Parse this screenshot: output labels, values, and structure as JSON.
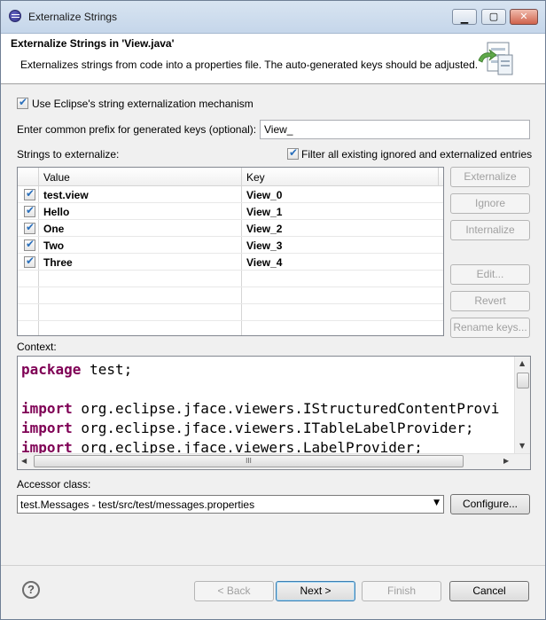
{
  "window": {
    "title": "Externalize Strings",
    "minimize_icon": "minimize-icon",
    "maximize_icon": "maximize-icon",
    "close_icon": "close-icon",
    "min_glyph": "▁",
    "max_glyph": "▢",
    "close_glyph": "✕"
  },
  "header": {
    "title": "Externalize Strings in 'View.java'",
    "description": "Externalizes strings from code into a properties file. The auto-generated keys should be adjusted.",
    "icon": "wizard-banner-icon"
  },
  "options": {
    "use_eclipse_mechanism_label": "Use Eclipse's string externalization mechanism",
    "use_eclipse_mechanism_checked": true,
    "prefix_label": "Enter common prefix for generated keys (optional):",
    "prefix_value": "View_",
    "strings_label": "Strings to externalize:",
    "filter_label": "Filter all existing ignored and externalized entries",
    "filter_checked": true
  },
  "table": {
    "columns": [
      "Value",
      "Key"
    ],
    "rows": [
      {
        "value": "test.view",
        "key": "View_0",
        "checked": true
      },
      {
        "value": "Hello",
        "key": "View_1",
        "checked": true
      },
      {
        "value": "One",
        "key": "View_2",
        "checked": true
      },
      {
        "value": "Two",
        "key": "View_3",
        "checked": true
      },
      {
        "value": "Three",
        "key": "View_4",
        "checked": true
      }
    ],
    "check_glyph": "✔"
  },
  "side_buttons": {
    "externalize": "Externalize",
    "ignore": "Ignore",
    "internalize": "Internalize",
    "edit": "Edit...",
    "revert": "Revert",
    "rename_keys": "Rename keys..."
  },
  "context": {
    "label": "Context:",
    "lines": [
      {
        "kw": "package",
        "rest": " test;"
      },
      {
        "kw": "",
        "rest": ""
      },
      {
        "kw": "import",
        "rest": " org.eclipse.jface.viewers.IStructuredContentProvi"
      },
      {
        "kw": "import",
        "rest": " org.eclipse.jface.viewers.ITableLabelProvider;"
      },
      {
        "kw": "import",
        "rest": " org.eclipse.jface.viewers.LabelProvider;"
      }
    ],
    "scroll_up": "▲",
    "scroll_down": "▼",
    "scroll_left": "◀",
    "scroll_right": "▶",
    "grip": "III"
  },
  "accessor": {
    "label": "Accessor class:",
    "selected": "test.Messages - test/src/test/messages.properties",
    "dropdown_glyph": "▼",
    "configure_button": "Configure..."
  },
  "footer": {
    "help_glyph": "?",
    "back_button": "< Back",
    "next_button": "Next >",
    "finish_button": "Finish",
    "cancel_button": "Cancel"
  },
  "colors": {
    "keyword": "#7f0055",
    "title_bar": "#c5d6ea",
    "checkbox_tick": "#2a6fbb"
  }
}
